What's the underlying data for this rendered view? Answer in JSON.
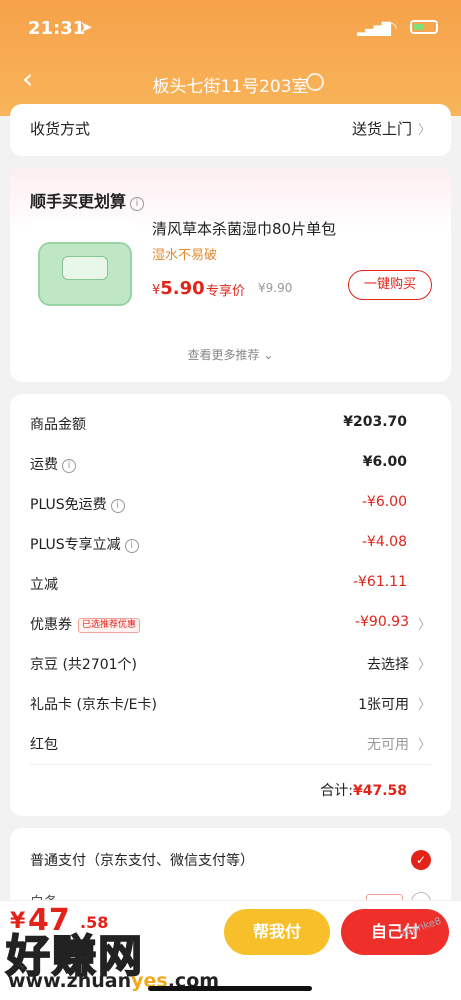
{
  "status_bar": {
    "time": "21:31"
  },
  "nav": {
    "title": "板头七街11号203室"
  },
  "delivery": {
    "label": "收货方式",
    "value": "送货上门"
  },
  "upsell": {
    "title": "顺手买更划算",
    "product_name": "清风草本杀菌湿巾80片单包",
    "product_sub": "湿水不易破",
    "price_symbol": "¥",
    "price": "5.90",
    "price_tag": "专享价",
    "original_price": "¥9.90",
    "buy_button": "一键购买",
    "see_more": "查看更多推荐"
  },
  "summary": {
    "rows": [
      {
        "label": "商品金额",
        "value": "¥203.70"
      },
      {
        "label": "运费",
        "value": "¥6.00"
      },
      {
        "label": "PLUS免运费",
        "value": "-¥6.00"
      },
      {
        "label": "PLUS专享立减",
        "value": "-¥4.08"
      },
      {
        "label": "立减",
        "value": "-¥61.11"
      },
      {
        "label": "优惠券",
        "chip": "已选推荐优惠",
        "value": "-¥90.93"
      },
      {
        "label": "京豆 (共2701个)",
        "value": "去选择"
      },
      {
        "label": "礼品卡 (京东卡/E卡)",
        "value": "1张可用"
      },
      {
        "label": "红包",
        "value": "无可用"
      }
    ],
    "total_label": "合计:",
    "total_value": "¥47.58"
  },
  "payment": {
    "option1": "普通支付（京东支付、微信支付等）",
    "option2": "白条"
  },
  "bottom": {
    "yen": "¥",
    "amount": "47",
    "amount_small": ".58",
    "help_pay": "帮我付",
    "self_pay": "自己付"
  },
  "watermark": {
    "text": "好赚网",
    "url_a": "www.zhuan",
    "url_b": "yes",
    "url_c": ".com",
    "corner": "zuanke8"
  }
}
